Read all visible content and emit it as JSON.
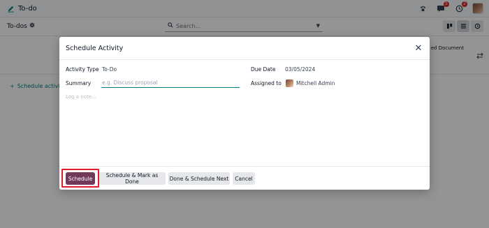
{
  "app": {
    "title": "To-do",
    "icons": {
      "logo": "pencil-icon",
      "phone": "phone-icon",
      "chat": "chat-icon",
      "activity": "clock-icon"
    },
    "badges": {
      "chat": "5",
      "activity": "2"
    }
  },
  "control_bar": {
    "breadcrumb": "To-dos",
    "search_placeholder": "Search..."
  },
  "list": {
    "column_label": "ed Document",
    "schedule_link": "Schedule activity"
  },
  "dialog": {
    "title": "Schedule Activity",
    "activity_type_label": "Activity Type",
    "activity_type_value": "To-Do",
    "summary_label": "Summary",
    "summary_placeholder": "e.g. Discuss proposal",
    "note_placeholder": "Log a note...",
    "due_date_label": "Due Date",
    "due_date_value": "03/05/2024",
    "assigned_to_label": "Assigned to",
    "assigned_to_value": "Mitchell Admin",
    "buttons": {
      "schedule": "Schedule",
      "schedule_mark_done": "Schedule & Mark as Done",
      "done_schedule_next": "Done & Schedule Next",
      "cancel": "Cancel"
    }
  },
  "colors": {
    "primary": "#71395a",
    "accent": "#017e84",
    "highlight": "#e11d2a"
  }
}
